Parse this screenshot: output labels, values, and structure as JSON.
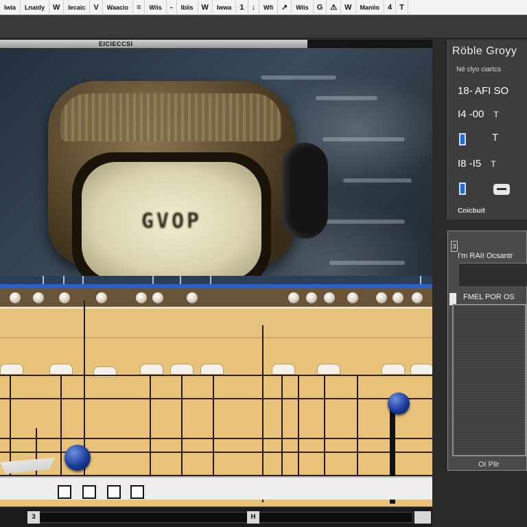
{
  "menubar": {
    "items": [
      "Iwia",
      "Lnaidy",
      "W",
      "Iecaic",
      "V",
      "Waacio",
      "≡",
      "Wiis",
      "-",
      "Ibiis",
      "W",
      "Iwwa",
      "1",
      "↓",
      "Wfi",
      "↗",
      "Wiis",
      "G",
      "⚠",
      "W",
      "Maniio",
      "4",
      "T"
    ]
  },
  "viewer": {
    "title": "EICIECCSI",
    "screen_text": "GVOP"
  },
  "panel": {
    "title": "Röble Groyy",
    "subtitle": "Né clyo ciartcs",
    "rows": [
      {
        "value": "18- AFI SO",
        "suffix": ""
      },
      {
        "value": "I4 -00",
        "suffix": "T"
      },
      {
        "value": "T",
        "suffix": ""
      },
      {
        "value": "I8 -I5",
        "suffix": "T"
      }
    ],
    "footer": "Cnicbuit"
  },
  "panel2": {
    "number": "3",
    "field_label": "I'm RAII Ocsantr",
    "list_label": "FMEL POR OS",
    "footer": "OI Plir"
  },
  "scrollbar": {
    "left_btn": "3",
    "mid_btn": "H"
  },
  "colors": {
    "timeline_bg": "#e9c27a",
    "accent_blue": "#2a5fc8",
    "panel_bg": "#3d3d3d"
  }
}
